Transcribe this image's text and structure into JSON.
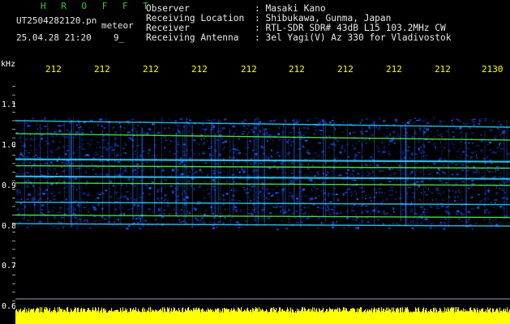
{
  "header": {
    "title": "H R O F F T",
    "filename": "UT2504282120.pn",
    "mode": "meteor",
    "date_time": "25.04.28 21:20",
    "number": "9_"
  },
  "info": [
    {
      "label": "Observer",
      "value": ": Masaki Kano"
    },
    {
      "label": "Receiving Location",
      "value": ": Shibukawa, Gunma, Japan"
    },
    {
      "label": "Receiver",
      "value": ": RTL-SDR SDR# 43dB L15 103.2MHz CW"
    },
    {
      "label": "Receiving Antenna",
      "value": ": 3el Yagi(V) Az 330 for Vladivostok"
    }
  ],
  "axis": {
    "unit": "kHz",
    "y_ticks": [
      "1.1",
      "1.0",
      "0.9",
      "0.8",
      "0.7",
      "0.6"
    ],
    "x_ticks": [
      "212",
      "212",
      "212",
      "212",
      "212",
      "212",
      "212",
      "212",
      "212",
      "2130"
    ]
  },
  "colors": {
    "background": "#000000",
    "title_green": "#35c835",
    "tick_yellow": "#ffff00",
    "band_cyan": "#30d8ff",
    "band_green": "#50ff50",
    "noise_blue": "#1030c0",
    "volume_yellow": "#ffff00"
  },
  "spectrogram": {
    "y_range_khz": [
      0.6,
      1.14
    ],
    "band_lower_khz": 0.8,
    "band_upper_khz": 1.04,
    "carrier_lines_khz": [
      1.04,
      1.01,
      0.95,
      0.935,
      0.91,
      0.895,
      0.85,
      0.82,
      0.8
    ]
  }
}
